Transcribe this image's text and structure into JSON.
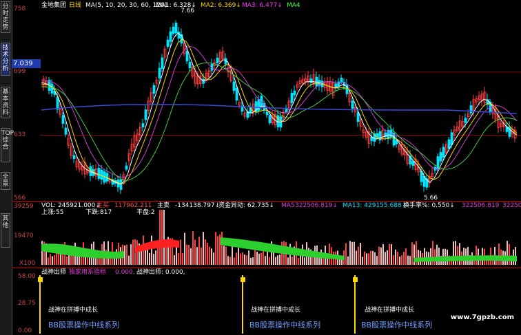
{
  "sidebar": {
    "tabs": [
      "分时走势",
      "技术分析",
      "基本资料",
      "TOP综合",
      "全景",
      "其他"
    ],
    "active": "技术分析"
  },
  "header": {
    "stock": "金地集团",
    "period": "日线",
    "ma_params": "MA(5, 10, 20, 30, 60, 120)",
    "ma1": "MA1: 6.328↓",
    "ma2": "MA2: 6.369↓",
    "ma3": "MA3: 6.477↓",
    "ma4": "MA4"
  },
  "price_panel": {
    "current_price": "7.039",
    "high_label": "7.66",
    "low_label": "5.66",
    "y_labels": [
      "758",
      "699",
      "633",
      "566"
    ]
  },
  "volume_panel": {
    "y_labels": [
      "39259",
      "19470",
      "X100"
    ],
    "vol": "VOL: 245921.000↓",
    "zhu_shi": "主买",
    "zhu_shi_val": "117962.211",
    "zhu_mai": "主卖",
    "zhu_mai_val": "-134138.797↓",
    "fund": "资金异动: 62.735↓",
    "ma5": "MA5",
    "ma5_val": "322506.819↓",
    "ma13": "MA13: 429155.688↓",
    "turnover": "换手率%: 0.550↓",
    "turnover_val": "322506.819",
    "extra": "322506",
    "up_count": "上涨:55",
    "down_count": "下跌:817",
    "flat_count": "平盘:2"
  },
  "indicator_panel": {
    "title": "战神出师",
    "subtitle": "独家用系指标",
    "val1": "0.000,",
    "val2": "战神出师: 0.000,",
    "y_labels": [
      "58.00",
      "28.75",
      "0.00"
    ],
    "notes": [
      "战神在拼搏中成长",
      "战神在拼搏中成长",
      "战神在拼搏中成长"
    ],
    "footer": [
      "BB股票操作中线系列",
      "BB股票操作中线系列",
      "BB股票操作中线系列"
    ]
  },
  "watermark": "www.7gpzb.com",
  "colors": {
    "up": "#ff4040",
    "down": "#00e5ff",
    "ma_white": "#ffffff",
    "ma_yellow": "#ffd700",
    "ma_magenta": "#d040d0",
    "ma_green": "#46c846",
    "ma_blue": "#3a4bd8",
    "grid": "#8b0000"
  }
}
